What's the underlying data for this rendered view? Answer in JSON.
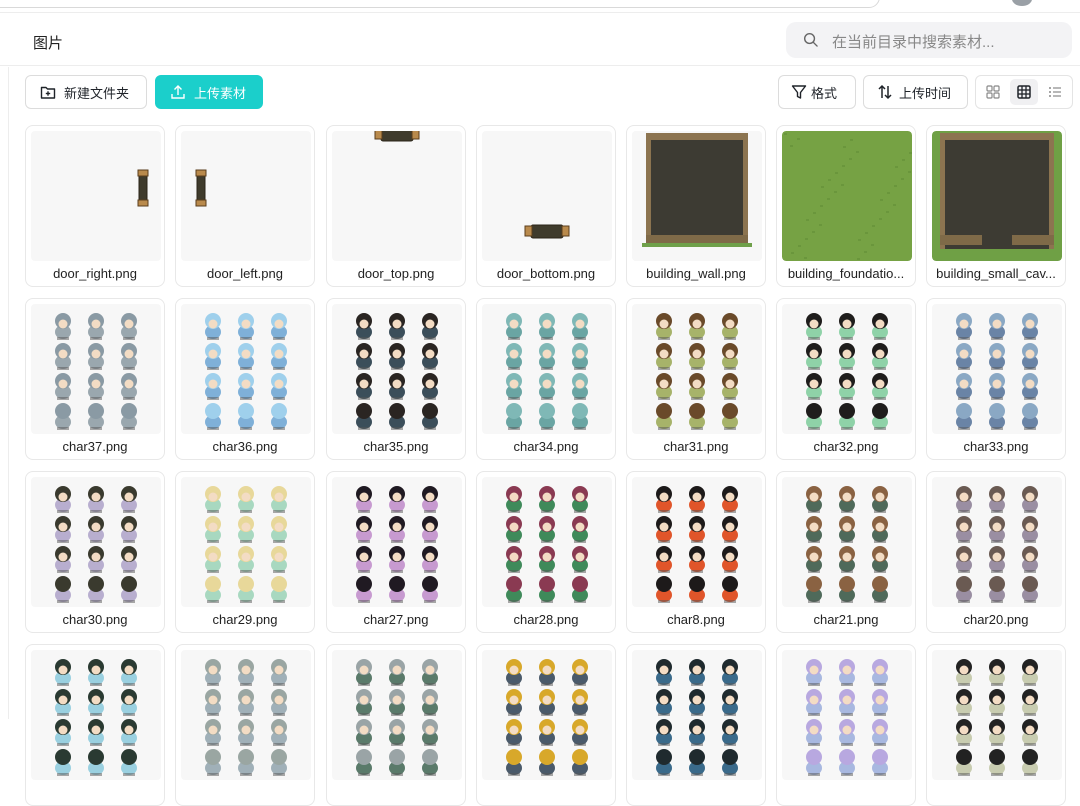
{
  "header": {
    "title": "图片"
  },
  "search": {
    "placeholder": "在当前目录中搜索素材..."
  },
  "toolbar": {
    "new_folder": "新建文件夹",
    "upload": "上传素材",
    "format": "格式",
    "sort": "上传时间"
  },
  "colors": {
    "accent": "#1bcfcb"
  },
  "files": [
    {
      "name": "door_right.png",
      "kind": "door-right"
    },
    {
      "name": "door_left.png",
      "kind": "door-left"
    },
    {
      "name": "door_top.png",
      "kind": "door-top"
    },
    {
      "name": "door_bottom.png",
      "kind": "door-bottom"
    },
    {
      "name": "building_wall.png",
      "kind": "wall"
    },
    {
      "name": "building_foundatio...",
      "kind": "grass"
    },
    {
      "name": "building_small_cav...",
      "kind": "cave"
    },
    {
      "name": "char37.png",
      "kind": "char",
      "hair": "#8a9aa4",
      "cloth": "#9aa7ae"
    },
    {
      "name": "char36.png",
      "kind": "char",
      "hair": "#9fd0ec",
      "cloth": "#7fb0d8"
    },
    {
      "name": "char35.png",
      "kind": "char",
      "hair": "#2a2522",
      "cloth": "#3b4e5a"
    },
    {
      "name": "char34.png",
      "kind": "char",
      "hair": "#7fb8b6",
      "cloth": "#6aa5a3"
    },
    {
      "name": "char31.png",
      "kind": "char",
      "hair": "#6a4a2a",
      "cloth": "#a7b36a"
    },
    {
      "name": "char32.png",
      "kind": "char",
      "hair": "#1f1d1c",
      "cloth": "#8fd2a8"
    },
    {
      "name": "char33.png",
      "kind": "char",
      "hair": "#8aa8c4",
      "cloth": "#6a84a6"
    },
    {
      "name": "char30.png",
      "kind": "char",
      "hair": "#3a3a2e",
      "cloth": "#b8aecf"
    },
    {
      "name": "char29.png",
      "kind": "char",
      "hair": "#e8d89a",
      "cloth": "#a8d8c0"
    },
    {
      "name": "char27.png",
      "kind": "char",
      "hair": "#201a22",
      "cloth": "#c79ad0"
    },
    {
      "name": "char28.png",
      "kind": "char",
      "hair": "#8a3a52",
      "cloth": "#3f8a5a"
    },
    {
      "name": "char8.png",
      "kind": "char",
      "hair": "#1d1a1a",
      "cloth": "#e0552a"
    },
    {
      "name": "char21.png",
      "kind": "char",
      "hair": "#8a6242",
      "cloth": "#4f6a5a"
    },
    {
      "name": "char20.png",
      "kind": "char",
      "hair": "#6a5a52",
      "cloth": "#9a8ea2"
    },
    {
      "name": "",
      "kind": "char",
      "hair": "#2a3a32",
      "cloth": "#9ad0e0"
    },
    {
      "name": "",
      "kind": "char",
      "hair": "#9aa6a2",
      "cloth": "#a0b0b8"
    },
    {
      "name": "",
      "kind": "char",
      "hair": "#9aa4a6",
      "cloth": "#5a7a6a"
    },
    {
      "name": "",
      "kind": "char",
      "hair": "#d8a82a",
      "cloth": "#4a5a6a"
    },
    {
      "name": "",
      "kind": "char",
      "hair": "#1f2a2e",
      "cloth": "#3a6a8a"
    },
    {
      "name": "",
      "kind": "char",
      "hair": "#b8a8e0",
      "cloth": "#a8b8e0"
    },
    {
      "name": "",
      "kind": "char",
      "hair": "#222222",
      "cloth": "#c8ccb0"
    }
  ]
}
